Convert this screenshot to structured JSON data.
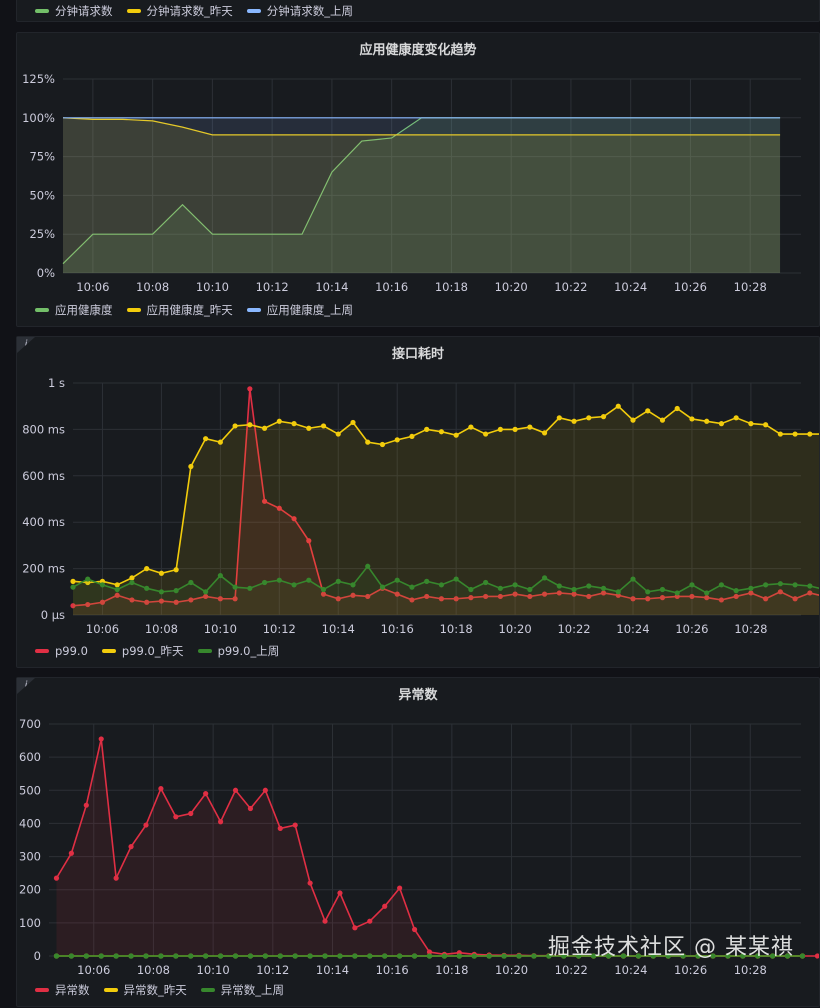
{
  "top_legend": {
    "items": [
      {
        "label": "分钟请求数",
        "color": "#73bf69"
      },
      {
        "label": "分钟请求数_昨天",
        "color": "#f2cc0c"
      },
      {
        "label": "分钟请求数_上周",
        "color": "#8ab8ff"
      }
    ]
  },
  "panels": [
    {
      "title": "应用健康度变化趋势"
    },
    {
      "title": "接口耗时",
      "info_icon": "info-icon"
    },
    {
      "title": "异常数",
      "info_icon": "info-icon"
    }
  ],
  "watermark": "掘金技术社区 @ 某某祺",
  "chart_data": [
    {
      "type": "area",
      "title": "应用健康度变化趋势",
      "x": [
        "10:05",
        "10:06",
        "10:07",
        "10:08",
        "10:09",
        "10:10",
        "10:11",
        "10:12",
        "10:13",
        "10:14",
        "10:15",
        "10:16",
        "10:17",
        "10:18",
        "10:19",
        "10:20",
        "10:21",
        "10:22",
        "10:23",
        "10:24",
        "10:25",
        "10:26",
        "10:27",
        "10:28",
        "10:29"
      ],
      "x_ticks": [
        "10:06",
        "10:08",
        "10:10",
        "10:12",
        "10:14",
        "10:16",
        "10:18",
        "10:20",
        "10:22",
        "10:24",
        "10:26",
        "10:28"
      ],
      "y_ticks": [
        "0%",
        "25%",
        "50%",
        "75%",
        "100%",
        "125%"
      ],
      "ylim": [
        0,
        125
      ],
      "grid": true,
      "series": [
        {
          "name": "应用健康度",
          "color": "#73bf69",
          "values": [
            6,
            25,
            25,
            25,
            44,
            25,
            25,
            25,
            25,
            65,
            85,
            87,
            100,
            100,
            100,
            100,
            100,
            100,
            100,
            100,
            100,
            100,
            100,
            100,
            100
          ]
        },
        {
          "name": "应用健康度_昨天",
          "color": "#f2cc0c",
          "values": [
            100,
            99,
            99,
            98,
            94,
            89,
            89,
            89,
            89,
            89,
            89,
            89,
            89,
            89,
            89,
            89,
            89,
            89,
            89,
            89,
            89,
            89,
            89,
            89,
            89
          ]
        },
        {
          "name": "应用健康度_上周",
          "color": "#8ab8ff",
          "values": [
            100,
            100,
            100,
            100,
            100,
            100,
            100,
            100,
            100,
            100,
            100,
            100,
            100,
            100,
            100,
            100,
            100,
            100,
            100,
            100,
            100,
            100,
            100,
            100,
            100
          ]
        }
      ],
      "legend": {
        "position": "bottom-left"
      }
    },
    {
      "type": "line",
      "title": "接口耗时",
      "x_ticks": [
        "10:06",
        "10:08",
        "10:10",
        "10:12",
        "10:14",
        "10:16",
        "10:18",
        "10:20",
        "10:22",
        "10:24",
        "10:26",
        "10:28"
      ],
      "y_ticks": [
        "0 µs",
        "200 ms",
        "400 ms",
        "600 ms",
        "800 ms",
        "1 s"
      ],
      "ylim": [
        0,
        1000
      ],
      "grid": true,
      "x_start": "10:05",
      "x_step_minutes": 0.5,
      "series": [
        {
          "name": "p99.0",
          "color": "#e02f44",
          "values": [
            40,
            45,
            55,
            85,
            65,
            55,
            60,
            55,
            65,
            80,
            70,
            70,
            975,
            490,
            460,
            415,
            320,
            90,
            70,
            85,
            80,
            115,
            90,
            65,
            80,
            70,
            70,
            75,
            80,
            80,
            90,
            80,
            90,
            95,
            90,
            80,
            95,
            85,
            70,
            70,
            75,
            80,
            80,
            75,
            65,
            80,
            95,
            70,
            100,
            70,
            95,
            80
          ]
        },
        {
          "name": "p99.0_昨天",
          "color": "#f2cc0c",
          "values": [
            145,
            140,
            145,
            130,
            160,
            200,
            180,
            195,
            640,
            760,
            745,
            815,
            820,
            805,
            835,
            825,
            805,
            815,
            780,
            830,
            745,
            735,
            755,
            770,
            800,
            790,
            775,
            810,
            780,
            800,
            800,
            810,
            785,
            850,
            835,
            850,
            855,
            900,
            840,
            880,
            840,
            890,
            845,
            835,
            825,
            850,
            825,
            820,
            780,
            780,
            780,
            780
          ]
        },
        {
          "name": "p99.0_上周",
          "color": "#37872d",
          "values": [
            120,
            155,
            130,
            110,
            140,
            115,
            100,
            105,
            140,
            100,
            170,
            120,
            115,
            140,
            150,
            130,
            150,
            110,
            145,
            130,
            210,
            120,
            150,
            120,
            145,
            130,
            155,
            110,
            140,
            115,
            130,
            110,
            160,
            125,
            110,
            125,
            115,
            100,
            155,
            100,
            110,
            95,
            130,
            95,
            130,
            105,
            115,
            130,
            135,
            130,
            125,
            110
          ]
        }
      ],
      "legend": {
        "position": "bottom-left"
      }
    },
    {
      "type": "line",
      "title": "异常数",
      "x_ticks": [
        "10:06",
        "10:08",
        "10:10",
        "10:12",
        "10:14",
        "10:16",
        "10:18",
        "10:20",
        "10:22",
        "10:24",
        "10:26",
        "10:28"
      ],
      "y_ticks": [
        "0",
        "100",
        "200",
        "300",
        "400",
        "500",
        "600",
        "700"
      ],
      "ylim": [
        0,
        700
      ],
      "grid": true,
      "x_start": "10:05",
      "x_step_minutes": 0.5,
      "series": [
        {
          "name": "异常数",
          "color": "#e02f44",
          "values": [
            235,
            310,
            455,
            655,
            235,
            330,
            395,
            505,
            420,
            430,
            490,
            405,
            500,
            445,
            500,
            385,
            395,
            220,
            105,
            190,
            85,
            105,
            150,
            205,
            80,
            12,
            5,
            10,
            5,
            3,
            2,
            2,
            1,
            1,
            1,
            0,
            0,
            0,
            0,
            0,
            0,
            0,
            0,
            0,
            0,
            0,
            0,
            0,
            0,
            0,
            0,
            0,
            0,
            0,
            0,
            0,
            0,
            0,
            0,
            0,
            0
          ]
        },
        {
          "name": "异常数_昨天",
          "color": "#f2cc0c",
          "values": [
            0,
            0,
            0,
            0,
            0,
            0,
            0,
            0,
            0,
            0,
            0,
            0,
            0,
            0,
            0,
            0,
            0,
            0,
            0,
            0,
            0,
            0,
            0,
            0,
            0,
            0,
            0,
            0,
            0,
            0,
            0,
            0,
            0,
            0,
            0,
            0,
            0,
            0,
            0,
            0,
            0,
            0,
            0,
            0,
            0,
            0,
            0,
            0,
            0,
            0,
            0
          ]
        },
        {
          "name": "异常数_上周",
          "color": "#37872d",
          "values": [
            0,
            0,
            0,
            0,
            0,
            0,
            0,
            0,
            0,
            0,
            0,
            0,
            0,
            0,
            0,
            0,
            0,
            0,
            0,
            0,
            0,
            0,
            0,
            0,
            0,
            0,
            0,
            0,
            0,
            0,
            0,
            0,
            0,
            0,
            0,
            0,
            0,
            0,
            0,
            0,
            0,
            0,
            0,
            0,
            0,
            0,
            0,
            0,
            0,
            0,
            0
          ]
        }
      ],
      "legend": {
        "position": "bottom-left"
      }
    }
  ]
}
